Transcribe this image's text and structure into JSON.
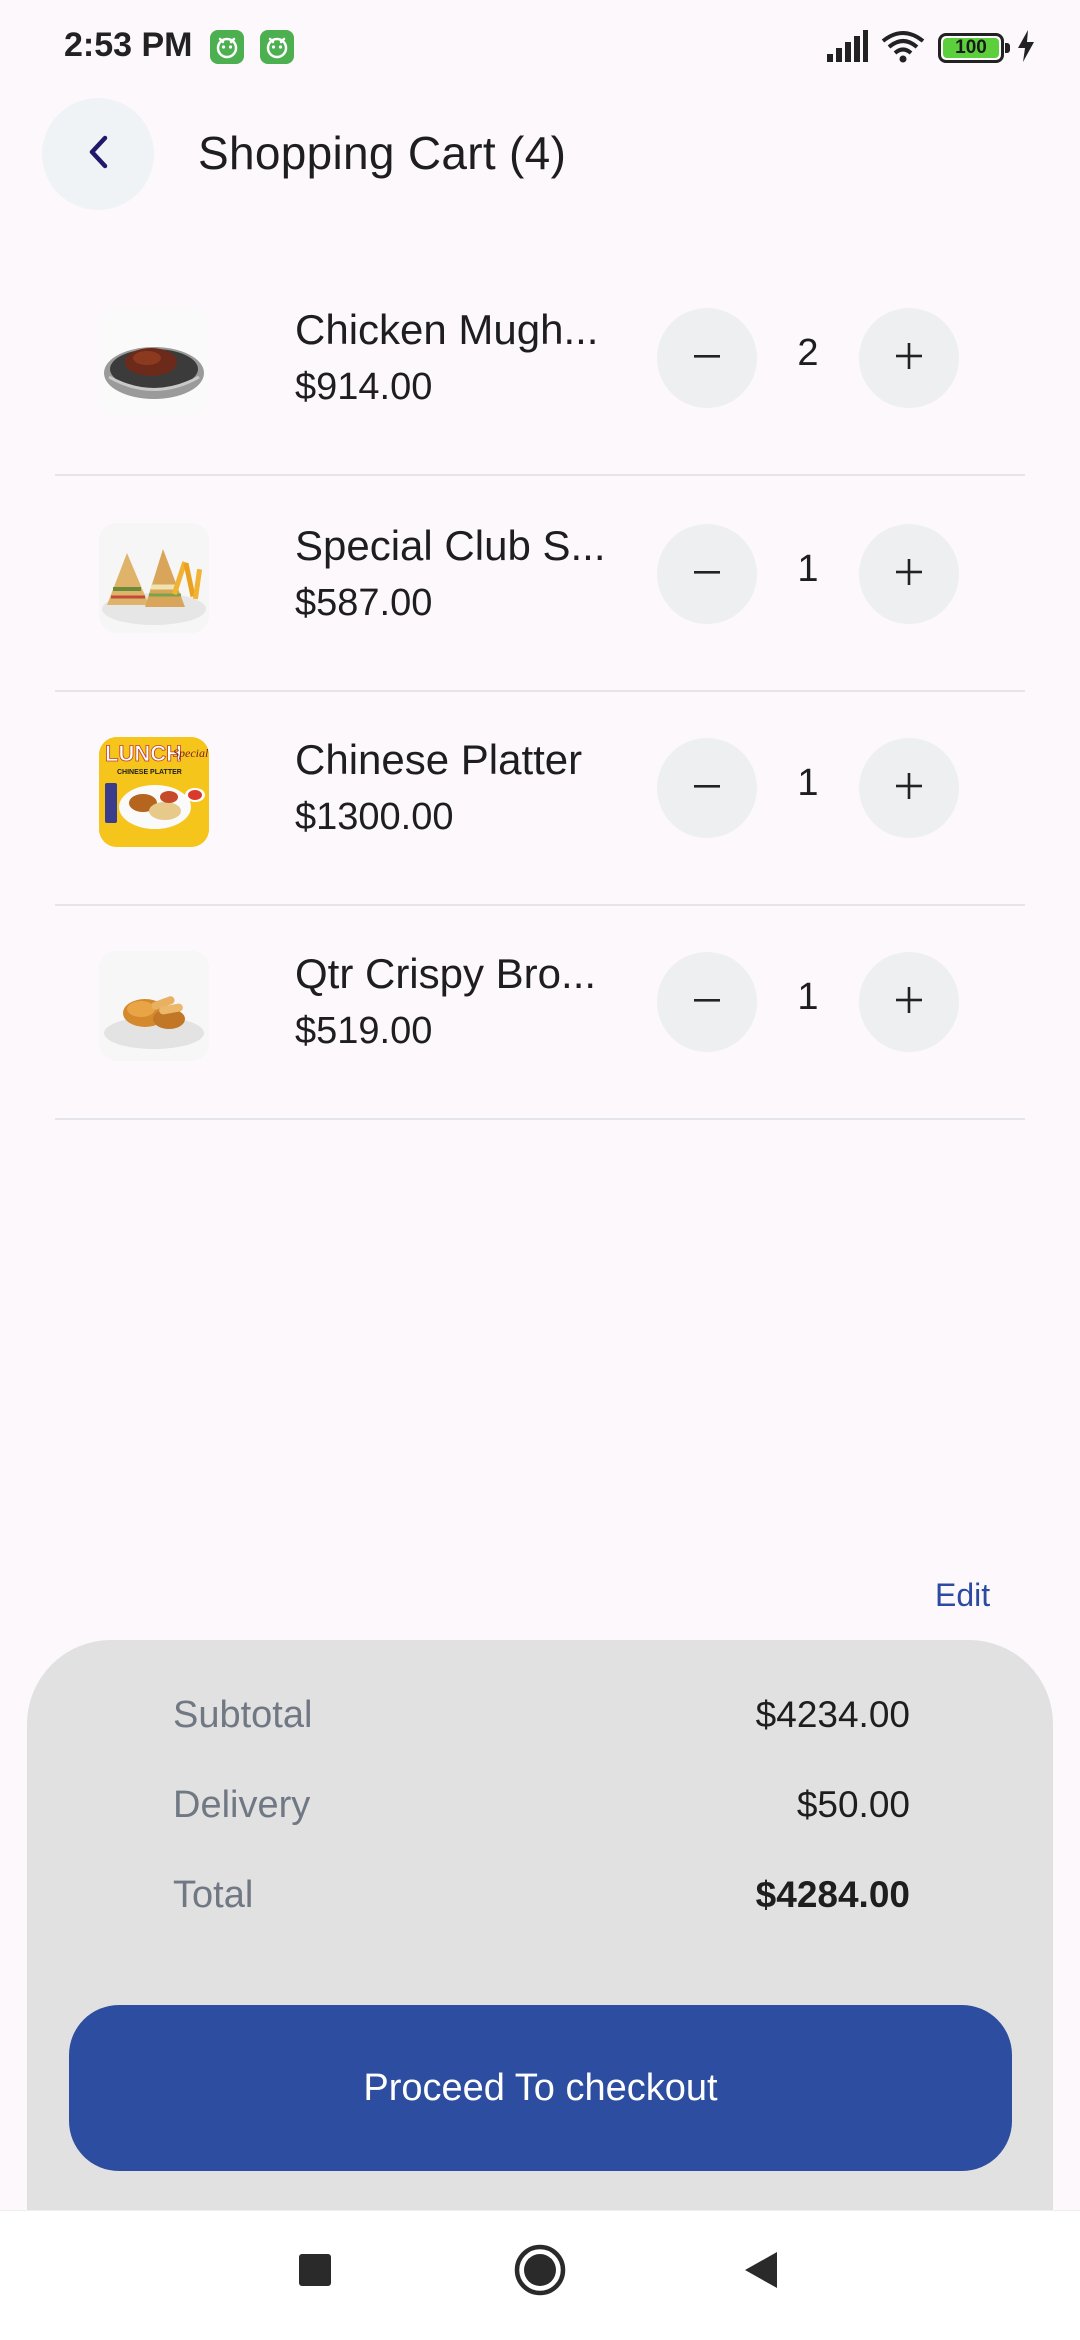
{
  "status_bar": {
    "time": "2:53 PM",
    "battery_level": "100",
    "icons": [
      "app-notification-icon",
      "app-notification-icon",
      "cellular-signal-icon",
      "wifi-icon",
      "battery-icon",
      "charging-bolt-icon"
    ]
  },
  "header": {
    "back_icon": "chevron-left-icon",
    "title": "Shopping Cart (4)"
  },
  "cart": {
    "items": [
      {
        "name": "Chicken Mugh...",
        "price": "$914.00",
        "quantity": "2",
        "image": "sizzler-plate-thumbnail"
      },
      {
        "name": "Special Club S...",
        "price": "$587.00",
        "quantity": "1",
        "image": "club-sandwich-thumbnail"
      },
      {
        "name": "Chinese Platter",
        "price": "$1300.00",
        "quantity": "1",
        "image": "lunch-special-platter-thumbnail",
        "image_text": "LUNCH Special CHINESE PLATTER"
      },
      {
        "name": "Qtr Crispy Bro...",
        "price": "$519.00",
        "quantity": "1",
        "image": "crispy-broast-thumbnail"
      }
    ],
    "decrement_icon": "minus-icon",
    "increment_icon": "plus-icon"
  },
  "summary": {
    "edit_label": "Edit",
    "rows": [
      {
        "label": "Subtotal",
        "value": "$4234.00"
      },
      {
        "label": "Delivery",
        "value": "$50.00"
      },
      {
        "label": "Total",
        "value": "$4284.00"
      }
    ],
    "checkout_label": "Proceed To checkout"
  },
  "nav_bar": {
    "icons": [
      "recents-square-icon",
      "home-circle-icon",
      "back-triangle-icon"
    ]
  },
  "colors": {
    "background": "#fdf8fc",
    "accent": "#2d4da0",
    "summary_panel": "#e1e1e1",
    "label_gray": "#707884"
  }
}
